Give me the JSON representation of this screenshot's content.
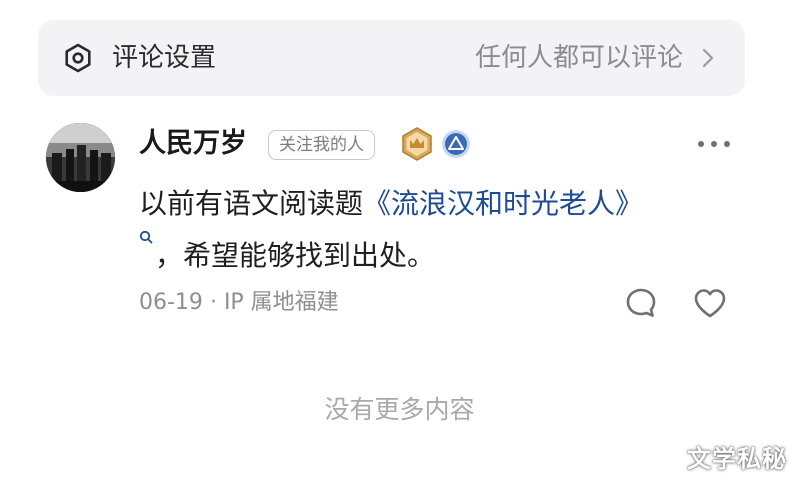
{
  "settings": {
    "label": "评论设置",
    "value": "任何人都可以评论",
    "icon": "settings-hexagon-icon"
  },
  "comment": {
    "username": "人民万岁",
    "follow_tag": "关注我的人",
    "badges": [
      "crown-badge-icon",
      "level-badge-icon"
    ],
    "text_before_link": "以前有语文阅读题",
    "link_text": "《流浪汉和时光老人》",
    "text_after_link": "，希望能够找到出处。",
    "date": "06-19",
    "separator": "·",
    "location": "IP 属地福建"
  },
  "footer": {
    "end_text": "没有更多内容"
  },
  "watermark": "文学私秘",
  "colors": {
    "link": "#1d4b97",
    "settings_bg": "#f3f3f5",
    "muted": "#8e8e93",
    "crown_badge": "#c9984a",
    "level_badge": "#3b6bb5"
  }
}
